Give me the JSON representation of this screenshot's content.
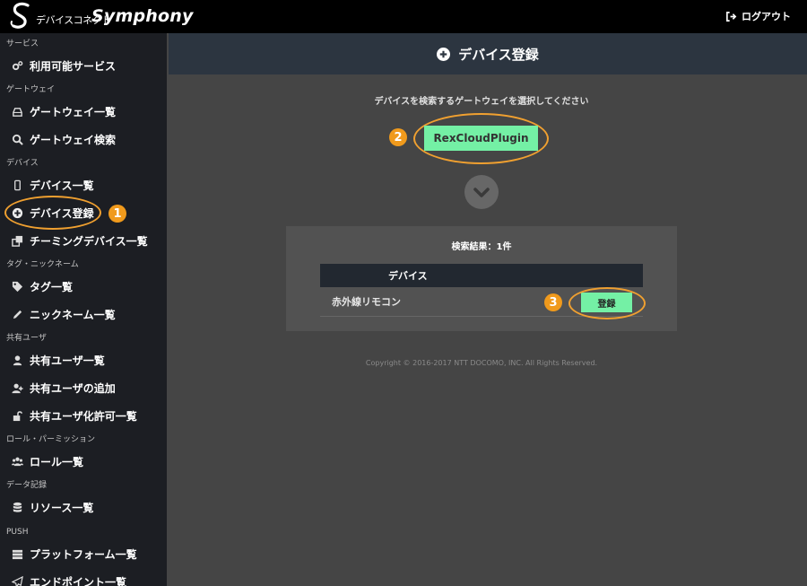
{
  "brand": {
    "logo_letter": "S",
    "jp": "デバイスコネクト",
    "en": "Symphony"
  },
  "topbar": {
    "logout_label": "ログアウト"
  },
  "sidebar": {
    "sections": [
      {
        "title": "サービス",
        "items": [
          {
            "label": "利用可能サービス",
            "icon": "cogs-icon"
          }
        ]
      },
      {
        "title": "ゲートウェイ",
        "items": [
          {
            "label": "ゲートウェイ一覧",
            "icon": "hdd-icon"
          },
          {
            "label": "ゲートウェイ検索",
            "icon": "search-icon"
          }
        ]
      },
      {
        "title": "デバイス",
        "items": [
          {
            "label": "デバイス一覧",
            "icon": "mobile-icon"
          },
          {
            "label": "デバイス登録",
            "icon": "plus-circle-icon"
          },
          {
            "label": "チーミングデバイス一覧",
            "icon": "clone-icon"
          }
        ]
      },
      {
        "title": "タグ・ニックネーム",
        "items": [
          {
            "label": "タグ一覧",
            "icon": "tag-icon"
          },
          {
            "label": "ニックネーム一覧",
            "icon": "pencil-icon"
          }
        ]
      },
      {
        "title": "共有ユーザ",
        "items": [
          {
            "label": "共有ユーザ一覧",
            "icon": "user-icon"
          },
          {
            "label": "共有ユーザの追加",
            "icon": "user-plus-icon"
          },
          {
            "label": "共有ユーザ化許可一覧",
            "icon": "unlock-icon"
          }
        ]
      },
      {
        "title": "ロール・パーミッション",
        "items": [
          {
            "label": "ロール一覧",
            "icon": "users-icon"
          }
        ]
      },
      {
        "title": "データ記録",
        "items": [
          {
            "label": "リソース一覧",
            "icon": "database-icon"
          }
        ]
      },
      {
        "title": "PUSH",
        "items": [
          {
            "label": "プラットフォーム一覧",
            "icon": "server-icon"
          },
          {
            "label": "エンドポイント一覧",
            "icon": "paper-plane-icon"
          }
        ]
      }
    ]
  },
  "main": {
    "title": "デバイス登録",
    "prompt": "デバイスを検索するゲートウェイを選択してください",
    "gateway_button": "RexCloudPlugin",
    "results_title": "検索結果：1件",
    "table": {
      "columns": [
        "デバイス"
      ],
      "rows": [
        {
          "name": "赤外線リモコン",
          "action": "登録"
        }
      ]
    },
    "copyright": "Copyright © 2016-2017 NTT DOCOMO, INC. All Rights Reserved."
  },
  "annotations": {
    "badge1": "1",
    "badge2": "2",
    "badge3": "3"
  },
  "colors": {
    "accent_green": "#74f0a5",
    "annotation_orange": "#f0a030",
    "header_bg": "#2c3540",
    "sidebar_bg": "#1c1e23"
  }
}
